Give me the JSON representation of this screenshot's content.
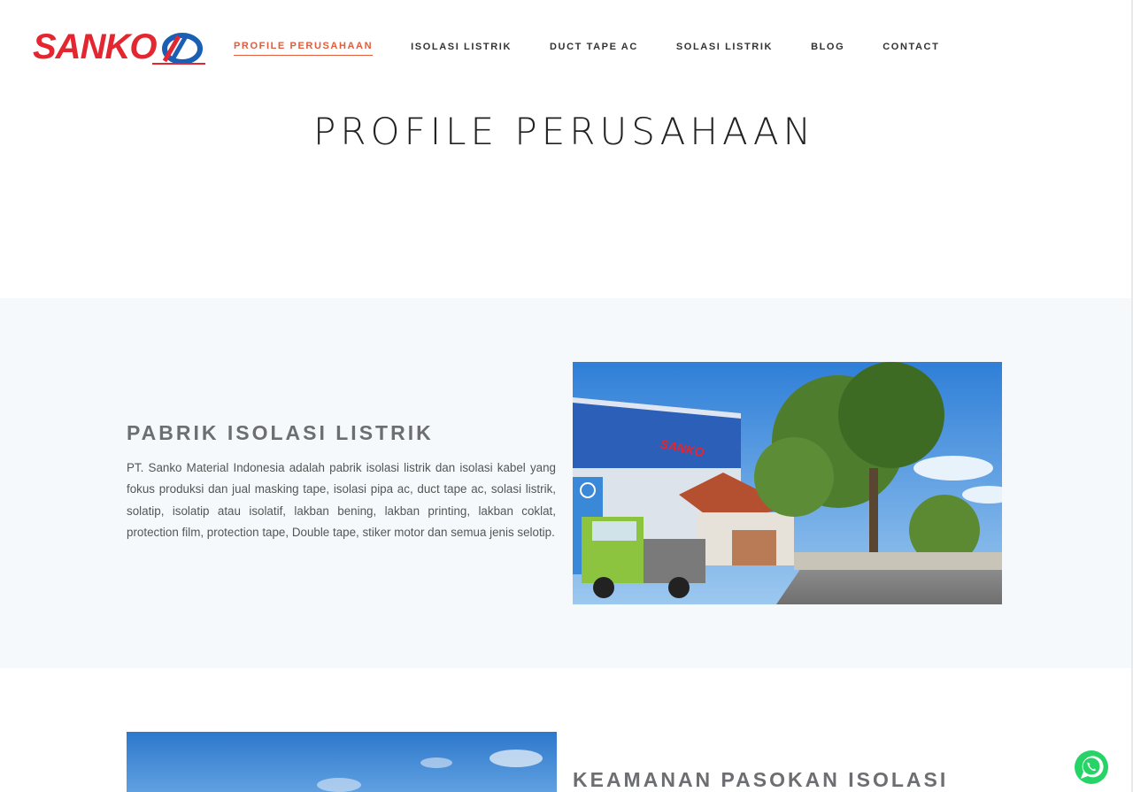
{
  "brand": {
    "logo_text": "SANKO",
    "logo_color": "#e3262f",
    "logo_accent_color": "#1a5fb4"
  },
  "nav": {
    "items": [
      {
        "label": "PROFILE PERUSAHAAN",
        "active": true
      },
      {
        "label": "ISOLASI LISTRIK",
        "active": false
      },
      {
        "label": "DUCT TAPE AC",
        "active": false
      },
      {
        "label": "SOLASI LISTRIK",
        "active": false
      },
      {
        "label": "BLOG",
        "active": false
      },
      {
        "label": "CONTACT",
        "active": false
      }
    ],
    "active_color": "#e25b3a"
  },
  "page": {
    "title": "PROFILE PERUSAHAAN"
  },
  "section1": {
    "heading": "PABRIK ISOLASI LISTRIK",
    "body": "PT. Sanko Material Indonesia adalah pabrik isolasi listrik dan isolasi kabel yang fokus produksi dan jual masking tape, isolasi pipa ac, duct tape ac, solasi listrik, solatip, isolatip atau isolatif, lakban bening, lakban printing, lakban coklat, protection film, protection tape, Double tape, stiker motor dan semua jenis selotip.",
    "photo": "factory-photo",
    "background": "#f5f9fc"
  },
  "section2": {
    "heading": "KEAMANAN PASOKAN ISOLASI",
    "photo": "sky-photo"
  },
  "floating": {
    "whatsapp_icon": "whatsapp-icon",
    "color": "#25d366"
  }
}
